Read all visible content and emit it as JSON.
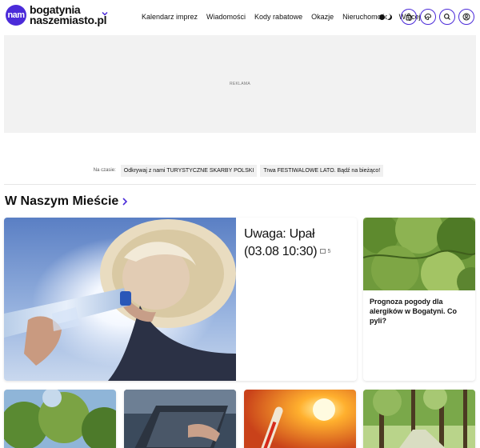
{
  "header": {
    "logo_badge": "nam",
    "logo_line1": "bogatynia",
    "logo_line2": "naszemiasto.pl",
    "nav": [
      "Kalendarz imprez",
      "Wiadomości",
      "Kody rabatowe",
      "Okazje",
      "Nieruchomości"
    ],
    "nav_more": "Więcej",
    "icons": [
      "theme-toggle-icon",
      "bag-icon",
      "paint-icon",
      "search-icon",
      "user-icon"
    ],
    "accent": "#4b2bd9"
  },
  "ad": {
    "label": "REKLAMA"
  },
  "trending": {
    "label": "Na czasie:",
    "items": [
      "Odkrywaj z nami TURYSTYCZNE SKARBY POLSKI",
      "Trwa FESTIWALOWE LATO. Bądź na bieżąco!"
    ]
  },
  "section": {
    "title": "W Naszym Mieście"
  },
  "articles": {
    "feature": {
      "title": "Uwaga: Upał (03.08 10:30)",
      "comments": "5"
    },
    "side": {
      "title": "Prognoza pogody dla alergików w Bogatyni. Co pyli?"
    }
  }
}
